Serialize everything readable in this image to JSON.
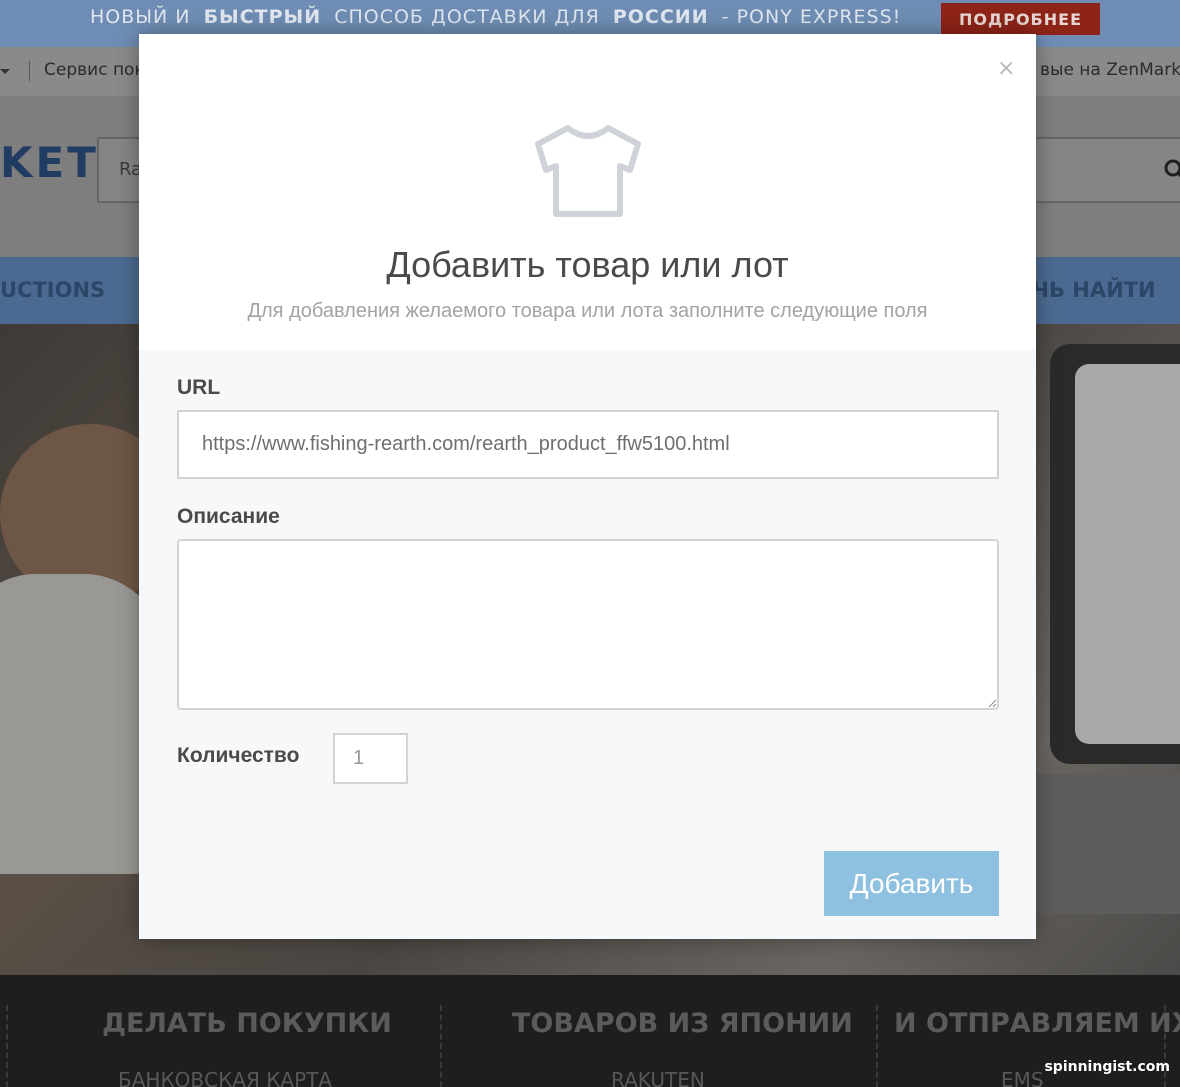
{
  "promo": {
    "part1": "НОВЫЙ И",
    "bold1": "БЫСТРЫЙ",
    "part2": "СПОСОБ ДОСТАВКИ ДЛЯ",
    "bold2": "РОССИИ",
    "part3": "- PONY EXPRESS!",
    "button": "ПОДРОБНЕЕ"
  },
  "topnav": {
    "left_text": "Сервис пок",
    "right_text": "вые на ZenMarke"
  },
  "header": {
    "logo_fragment": "KET",
    "search_placeholder_fragment": "Ra"
  },
  "mainnav": {
    "left_item": "UCTIONS",
    "right_item": "ЧЬ НАЙТИ"
  },
  "footer": {
    "columns": [
      {
        "heading": "ДЕЛАТЬ ПОКУПКИ",
        "sub": "БАНКОВСКАЯ КАРТА"
      },
      {
        "heading": "ТОВАРОВ ИЗ ЯПОНИИ",
        "sub": "RAKUTEN"
      },
      {
        "heading": "И ОТПРАВЛЯЕМ ИХ",
        "sub": "EMS"
      }
    ],
    "watermark": "spinningist.com"
  },
  "modal": {
    "close_label": "×",
    "icon": "tshirt-icon",
    "title": "Добавить товар или лот",
    "subtitle": "Для добавления желаемого товара или лота заполните следующие поля",
    "url_label": "URL",
    "url_value": "https://www.fishing-rearth.com/rearth_product_ffw5100.html",
    "description_label": "Описание",
    "description_value": "",
    "quantity_label": "Количество",
    "quantity_value": "1",
    "submit_label": "Добавить"
  },
  "colors": {
    "promo_bar": "#6f8db4",
    "promo_button": "#8e2418",
    "submit_button": "#8ec0df",
    "modal_body": "#f7f8fa"
  }
}
